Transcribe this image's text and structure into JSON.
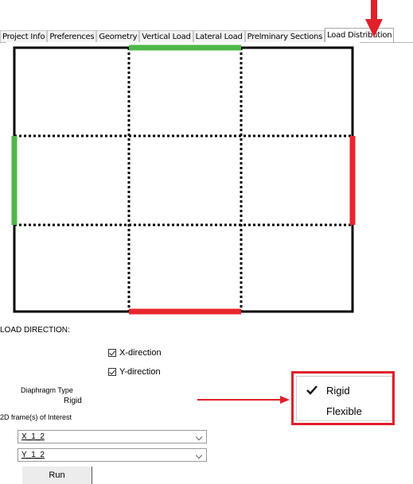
{
  "tabs": [
    {
      "label": "Project Info",
      "active": false
    },
    {
      "label": "Preferences",
      "active": false
    },
    {
      "label": "Geometry",
      "active": false
    },
    {
      "label": "Vertical Load",
      "active": false
    },
    {
      "label": "Lateral Load",
      "active": false
    },
    {
      "label": "Prelminary Sections",
      "active": false
    },
    {
      "label": "Load Distribution",
      "active": true
    }
  ],
  "load_direction": {
    "label": "LOAD DIRECTION:",
    "x_direction": {
      "label": "X-direction",
      "checked": true
    },
    "y_direction": {
      "label": "Y-direction",
      "checked": true
    }
  },
  "diaphragm": {
    "label": "Diaphragm Type",
    "value": "Rigid"
  },
  "frames": {
    "label": "2D frame(s) of Interest",
    "combo1": "X_1_2",
    "combo2": "Y_1_2"
  },
  "run_label": "Run",
  "popup": {
    "items": [
      {
        "label": "Rigid",
        "checked": true
      },
      {
        "label": "Flexible",
        "checked": false
      }
    ]
  },
  "colors": {
    "highlight_red": "#e0202a",
    "edge_green": "#4db848",
    "edge_red": "#e8252d",
    "grid": "#000000"
  },
  "icons": {
    "tab_marker": "down-arrow-icon",
    "callout": "right-arrow-icon",
    "check": "checkmark-icon"
  }
}
